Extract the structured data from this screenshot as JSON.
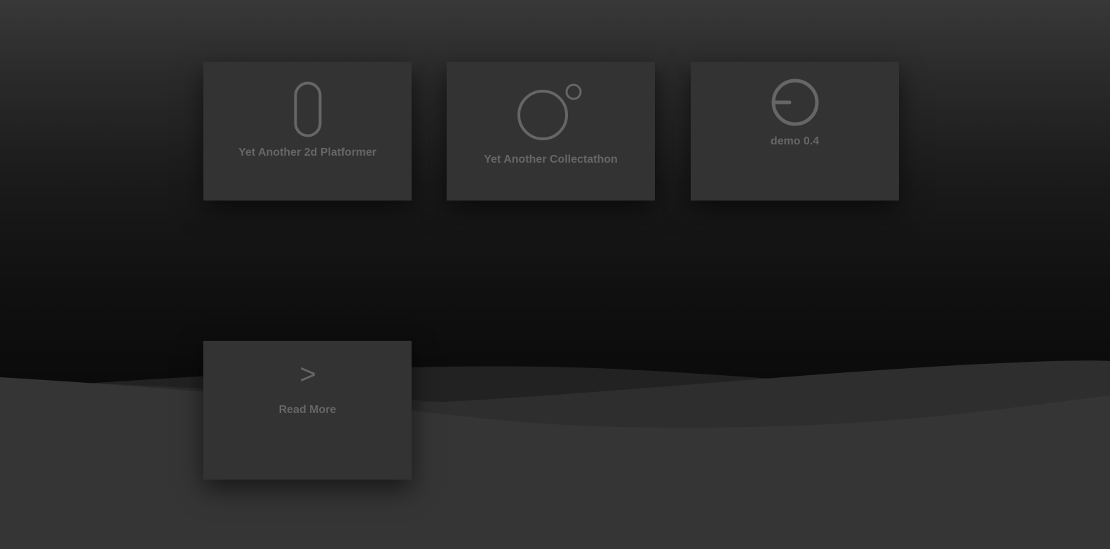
{
  "colors": {
    "background_top": "#383838",
    "background_bottom": "#0b0b0b",
    "card": "#333333",
    "text": "#666666",
    "wave_light": "#353535",
    "wave_mid": "#2a2a2a",
    "wave_dark": "#222222"
  },
  "cards": [
    {
      "title": "Yet Another 2d Platformer",
      "icon": "capsule-icon"
    },
    {
      "title": "Yet Another Collectathon",
      "icon": "collectible-rings-icon"
    },
    {
      "title": "demo 0.4",
      "icon": "power-dial-icon"
    },
    {
      "title": "Read More",
      "icon": "chevron-right-icon",
      "icon_glyph": ">"
    }
  ]
}
